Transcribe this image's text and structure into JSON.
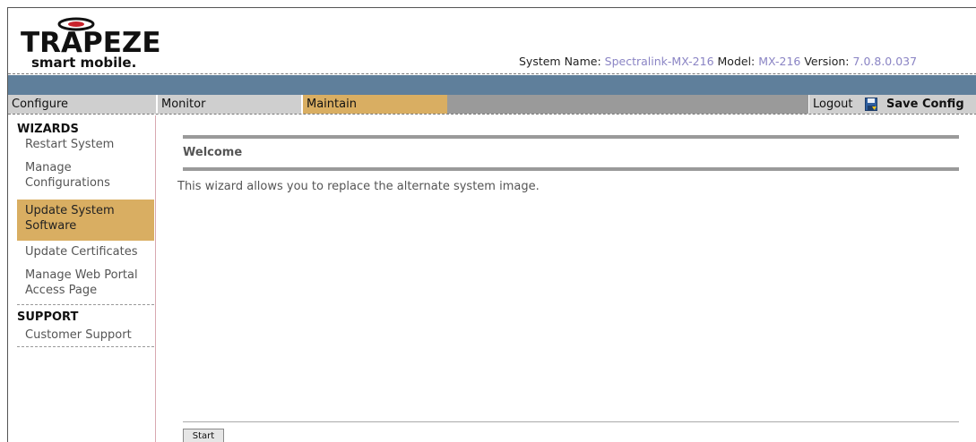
{
  "brand": {
    "name": "TRAPEZE",
    "tagline": "smart mobile."
  },
  "system": {
    "name_label": "System Name:",
    "name_value": "Spectralink-MX-216",
    "model_label": "Model:",
    "model_value": "MX-216",
    "version_label": "Version:",
    "version_value": "7.0.8.0.037"
  },
  "nav": {
    "tabs": [
      {
        "label": "Configure"
      },
      {
        "label": "Monitor"
      },
      {
        "label": "Maintain"
      }
    ],
    "logout_label": "Logout",
    "save_label": "Save Config"
  },
  "sidebar": {
    "wizards_title": "WIZARDS",
    "wizards": [
      {
        "label": "Restart System"
      },
      {
        "label": "Manage Configurations"
      },
      {
        "label": "Update System Software"
      },
      {
        "label": "Update Certificates"
      },
      {
        "label": "Manage Web Portal Access Page"
      }
    ],
    "support_title": "SUPPORT",
    "support": [
      {
        "label": "Customer Support"
      }
    ]
  },
  "main": {
    "heading": "Welcome",
    "description": "This wizard allows you to replace the alternate system image.",
    "start_label": "Start"
  },
  "colors": {
    "accent": "#d9ae62",
    "band": "#5f7f9b",
    "link": "#8a84c4"
  }
}
